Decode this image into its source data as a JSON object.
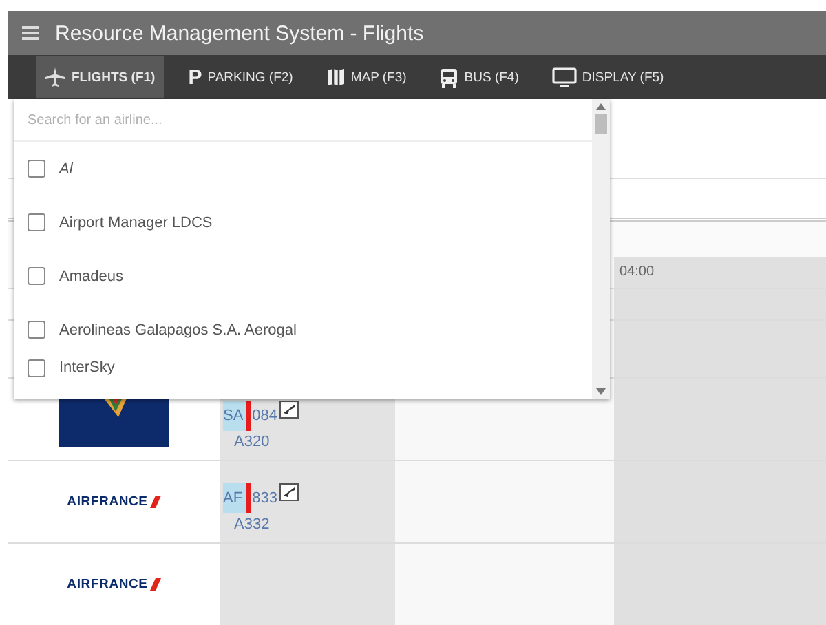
{
  "window": {
    "title": "Resource Management System - Flights"
  },
  "tabs": [
    {
      "label": "FLIGHTS (F1)",
      "selected": true
    },
    {
      "label": "PARKING (F2)",
      "glyph": "P",
      "selected": false
    },
    {
      "label": "MAP (F3)",
      "selected": false
    },
    {
      "label": "BUS (F4)",
      "selected": false
    },
    {
      "label": "DISPLAY (F5)",
      "selected": false
    }
  ],
  "airline_filter": {
    "search": {
      "placeholder": "Search for an airline..."
    },
    "items": [
      {
        "label": "Al",
        "italic": true,
        "checked": false
      },
      {
        "label": "Airport Manager LDCS",
        "italic": false,
        "checked": false
      },
      {
        "label": "Amadeus",
        "italic": false,
        "checked": false
      },
      {
        "label": "Aerolineas Galapagos S.A. Aerogal",
        "italic": false,
        "checked": false
      },
      {
        "label": "InterSky",
        "italic": false,
        "checked": false
      }
    ]
  },
  "timeline": {
    "time_label": "04:00",
    "rows": [
      {
        "logo": {
          "kind": "image"
        },
        "flight": {
          "number": "SA 084",
          "aircraft": "A320"
        }
      },
      {
        "logo": {
          "kind": "wordmark",
          "text": "AIRFRANCE"
        },
        "flight": {
          "number": "AF 833",
          "aircraft": "A332"
        }
      },
      {
        "logo": {
          "kind": "wordmark",
          "text": "AIRFRANCE"
        }
      }
    ]
  }
}
